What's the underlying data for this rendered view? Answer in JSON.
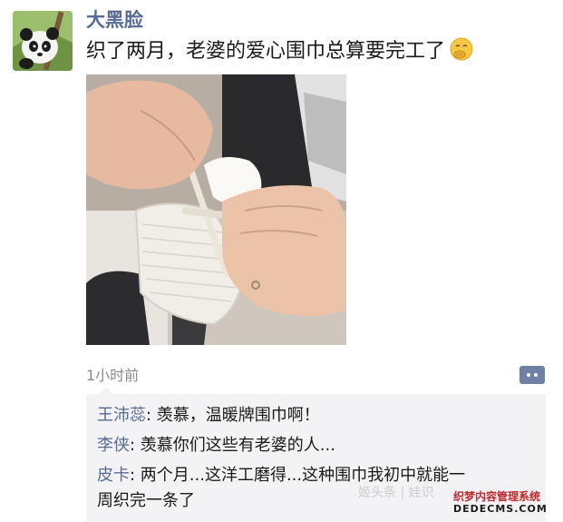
{
  "post": {
    "username": "大黑脸",
    "text": "织了两月，老婆的爱心围巾总算要完工了",
    "emoji_icon": "face-with-hand-over-mouth",
    "timestamp": "1小时前"
  },
  "comments": [
    {
      "author": "王沛蕊",
      "text": ": 羡慕，温暖牌围巾啊！"
    },
    {
      "author": "李侠",
      "text": ": 羡慕你们这些有老婆的人..."
    },
    {
      "author": "皮卡",
      "text": ": 两个月...这洋工磨得...这种围巾我初中就能一"
    },
    {
      "author": "",
      "text": "周织完一条了"
    }
  ],
  "watermark": {
    "text": "姬头条 | 娃识",
    "logo_line1": "织梦内容管理系统",
    "logo_line2": "DEDECMS.COM"
  },
  "colors": {
    "link_blue": "#576b95",
    "comment_bg": "#f3f3f5",
    "more_button": "#6f7fa5"
  }
}
